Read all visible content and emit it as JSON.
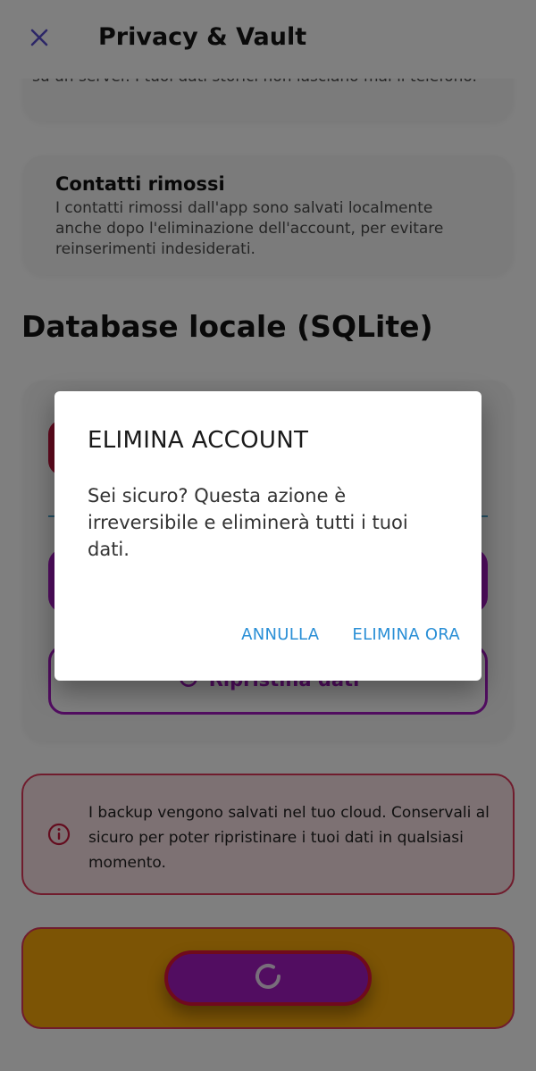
{
  "header": {
    "title": "Privacy & Vault",
    "close_icon": "close-icon"
  },
  "cards": [
    {
      "text": "su un server. I tuoi dati storici non lasciano mai il telefono."
    },
    {
      "title": "Contatti rimossi",
      "text": "I contatti rimossi dall'app sono salvati localmente anche dopo l'eliminazione dell'account, per evitare reinserimenti indesiderati."
    }
  ],
  "section": {
    "title": "Database locale (SQLite)",
    "restore_label": "Ripristina dati",
    "restore_icon": "history-icon"
  },
  "info": {
    "icon": "info-icon",
    "text": "I backup vengono salvati nel tuo cloud. Conservali al sicuro per poter ripristinare i tuoi dati in qualsiasi momento."
  },
  "loading": {
    "icon": "spinner-icon"
  },
  "dialog": {
    "title": "ELIMINA ACCOUNT",
    "message": "Sei sicuro? Questa azione è irreversibile e eliminerà tutti i tuoi dati.",
    "cancel_label": "ANNULLA",
    "confirm_label": "ELIMINA ORA"
  },
  "colors": {
    "accent_purple": "#a41bc2",
    "accent_red": "#e0385a",
    "warning_yellow": "#f8a80a",
    "dialog_action": "#2a8fd6",
    "close_icon": "#5a4fcf"
  }
}
